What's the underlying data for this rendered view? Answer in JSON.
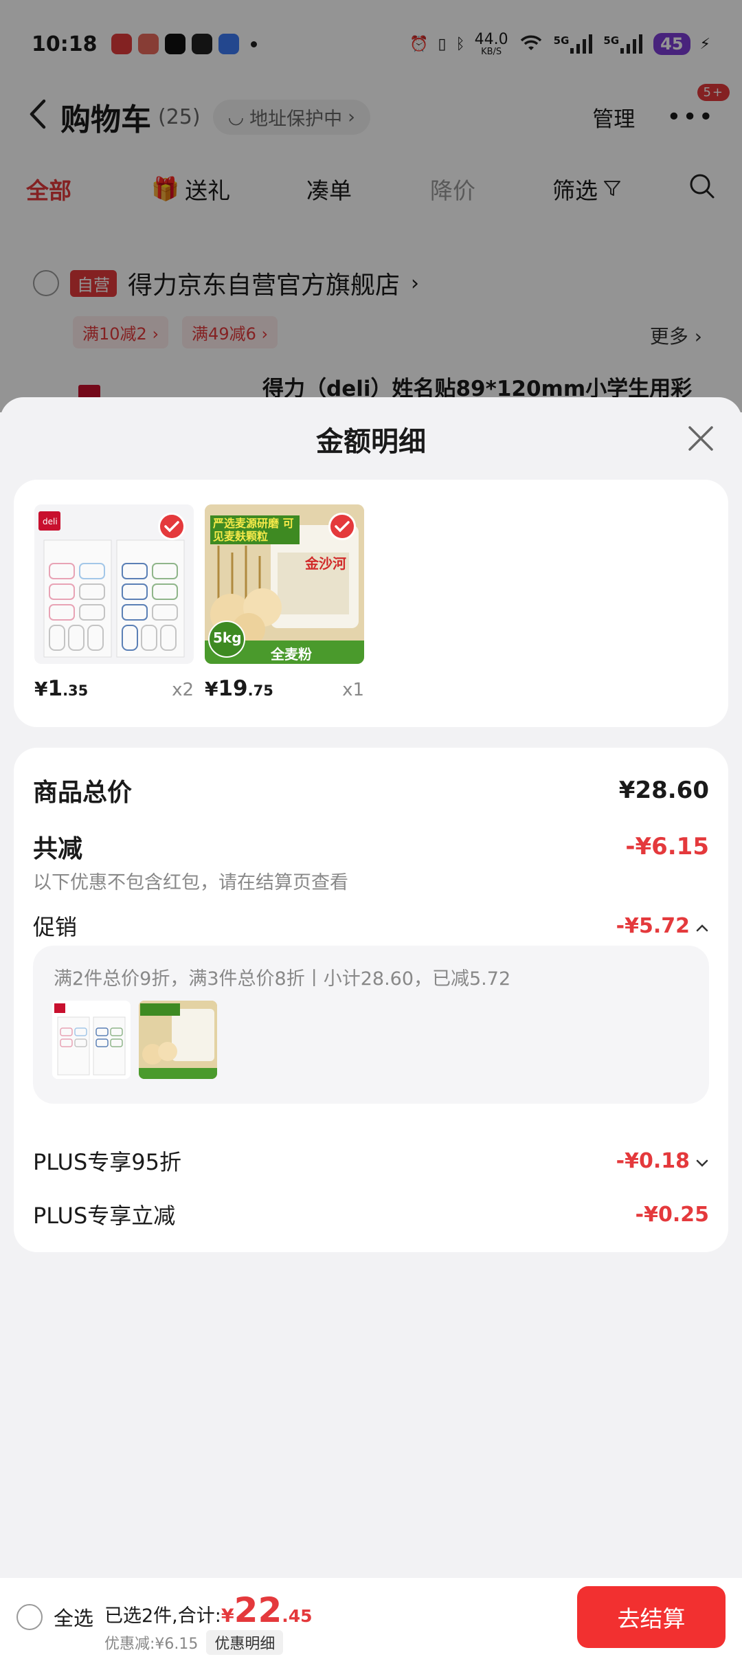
{
  "status_bar": {
    "time": "10:18",
    "net_speed": "44.0",
    "net_unit": "KB/S",
    "network_1": "5G",
    "network_2": "5G",
    "battery": "45"
  },
  "nav": {
    "title": "购物车",
    "count": "(25)",
    "address_protect": "地址保护中",
    "manage": "管理",
    "badge": "5+"
  },
  "tabs": {
    "all": "全部",
    "gift": "送礼",
    "bundle": "凑单",
    "price_drop": "降价",
    "filter": "筛选"
  },
  "store": {
    "self_tag": "自营",
    "name": "得力京东自营官方旗舰店",
    "promos": [
      "满10减2",
      "满49减6"
    ],
    "more": "更多",
    "product_title": "得力（deli）姓名贴89*120mm小学生用彩"
  },
  "sheet": {
    "title": "金额明细",
    "goods": [
      {
        "price_currency": "¥",
        "price_int": "1",
        "price_dec": ".35",
        "qty": "x2",
        "icon": "name-sticker-image"
      },
      {
        "price_currency": "¥",
        "price_int": "19",
        "price_dec": ".75",
        "qty": "x1",
        "icon": "flour-bag-image",
        "bag_text": "金沙河",
        "banner_text": "严选麦源研磨 可见麦麸颗粒",
        "weight": "5kg",
        "label": "全麦粉"
      }
    ],
    "total_label": "商品总价",
    "total_value": "¥28.60",
    "reduce_label": "共减",
    "reduce_value": "-¥6.15",
    "reduce_note": "以下优惠不包含红包，请在结算页查看",
    "promo_label": "促销",
    "promo_value": "-¥5.72",
    "promo_desc": "满2件总价9折，满3件总价8折丨小计28.60，已减5.72",
    "plus95_label": "PLUS专享95折",
    "plus95_value": "-¥0.18",
    "plus_direct_label": "PLUS专享立减",
    "plus_direct_value": "-¥0.25"
  },
  "bottom": {
    "select_all": "全选",
    "selected_text": "已选2件,合计:",
    "total_currency": "¥",
    "total_int": "22",
    "total_dec": ".45",
    "discount_text": "优惠减:¥6.15",
    "discount_detail": "优惠明细",
    "checkout": "去结算"
  },
  "colors": {
    "accent": "#e4393c",
    "checkout": "#f23030",
    "battery": "#7d3dd6"
  }
}
